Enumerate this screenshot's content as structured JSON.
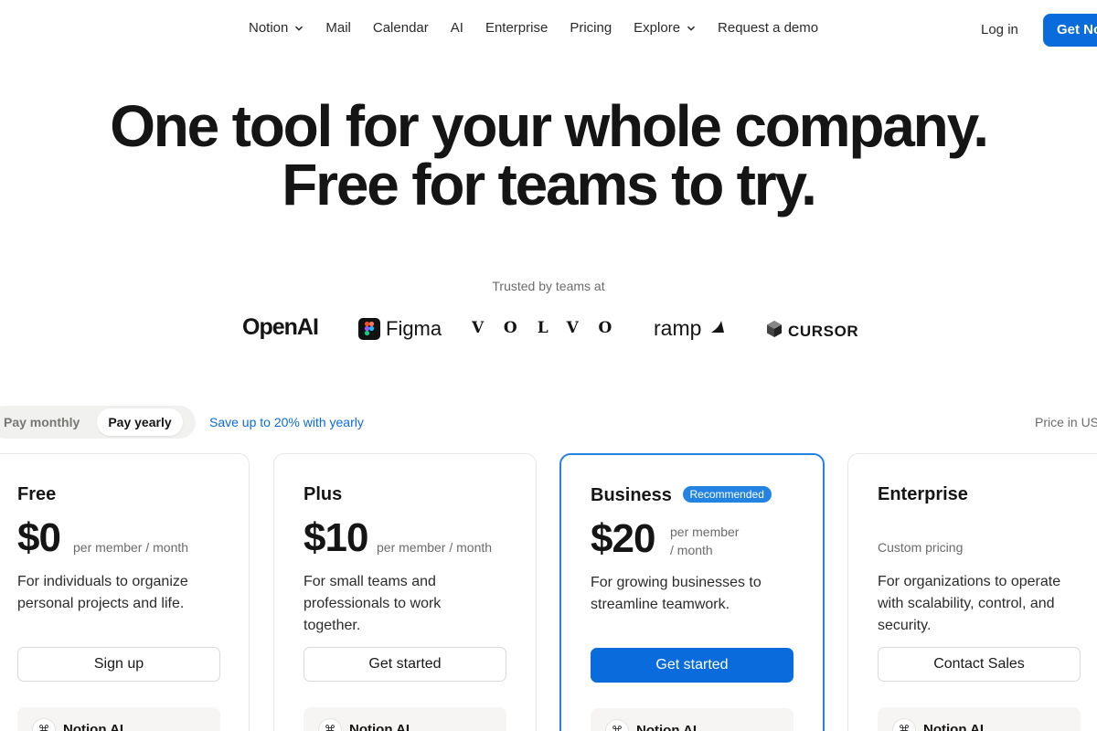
{
  "nav": {
    "items": [
      {
        "label": "Notion",
        "dropdown": true
      },
      {
        "label": "Mail",
        "dropdown": false
      },
      {
        "label": "Calendar",
        "dropdown": false
      },
      {
        "label": "AI",
        "dropdown": false
      },
      {
        "label": "Enterprise",
        "dropdown": false
      },
      {
        "label": "Pricing",
        "dropdown": false
      },
      {
        "label": "Explore",
        "dropdown": true
      },
      {
        "label": "Request a demo",
        "dropdown": false
      }
    ],
    "login": "Log in",
    "cta": "Get Notion free"
  },
  "hero": {
    "line1": "One tool for your whole company.",
    "line2": "Free for teams to try."
  },
  "trusted": {
    "label": "Trusted by teams at",
    "logos": [
      "OpenAI",
      "Figma",
      "VOLVO",
      "ramp",
      "CURSOR"
    ]
  },
  "billing": {
    "monthly": "Pay monthly",
    "yearly": "Pay yearly",
    "selected": "Pay yearly",
    "save_note": "Save up to 20% with yearly",
    "currency_note": "Price in US$"
  },
  "plans": [
    {
      "name": "Free",
      "price": "$0",
      "unit": "per member / month",
      "description": "For individuals to organize personal projects and life.",
      "button": "Sign up",
      "ai_label": "Notion AI"
    },
    {
      "name": "Plus",
      "price": "$10",
      "unit": "per member / month",
      "description": "For small teams and professionals to work together.",
      "button": "Get started",
      "ai_label": "Notion AI"
    },
    {
      "name": "Business",
      "badge": "Recommended",
      "price": "$20",
      "unit_line1": "per member",
      "unit_line2": "/ month",
      "description": "For growing businesses to streamline teamwork.",
      "button": "Get started",
      "ai_label": "Notion AI"
    },
    {
      "name": "Enterprise",
      "price_note": "Custom pricing",
      "description": "For organizations to operate with scalability, control, and security.",
      "button": "Contact Sales",
      "ai_label": "Notion AI"
    }
  ],
  "colors": {
    "accent": "#0a6bdc",
    "recommended_border": "#2383e2",
    "text": "#191919",
    "muted": "#6b6b6b"
  }
}
